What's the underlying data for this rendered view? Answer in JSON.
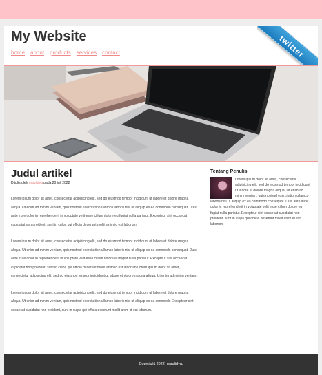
{
  "site": {
    "title": "My Website",
    "nav": [
      "home",
      "about",
      "products",
      "services",
      "contact"
    ],
    "ribbon_label": "twitter"
  },
  "article": {
    "title": "Judul artikel",
    "byline_prefix": "Ditulis oleh",
    "byline_author": "maulidya",
    "byline_suffix": "pada 20 juli 2022",
    "paragraphs": [
      "Lorem ipsum dolor sit amet, consectetur adipisicing elit, sed do eiusmod tempor incididunt ut labore et dolore magna aliqua. Ut enim ad minim veniam, quis nostrud exercitation ullamco laboris nisi ut aliquip ex ea commodo consequat. Duis aute irure dolor in reprehenderit in voluptate velit esse cillum dolore eu fugiat nulla pariatur. Excepteur sint occaecat cupidatat non proident, sunt in culpa qui officia deserunt mollit anim id est laborum.",
      "Lorem ipsum dolor sit amet, consectetur adipisicing elit, sed do eiusmod tempor incididunt ut labore et dolore magna aliqua. Ut enim ad minim veniam, quis nostrud exercitation ullamco laboris nisi ut aliquip ex ea commodo consequat. Duis aute irure dolor in reprehenderit in voluptate velit esse cillum dolore eu fugiat nulla pariatur. Excepteur sint occaecat cupidatat non proident, sunt in culpa qui officia deserunt mollit anim id est laborum.Lorem ipsum dolor sit amet, consectetur adipisicing elit, sed do eiusmod tempor incididunt ut labore et dolore magna aliqua. Ut enim ad minim veniam.",
      "Lorem ipsum dolor sit amet, consectetur adipisicing elit, sed do eiusmod tempor incididunt ut labore et dolore magna aliqua. Ut enim ad minim veniam, quis nostrud exercitation ullamco laboris nisi ut aliquip ex ea commodo Excepteur sint occaecat cupidatat non proident, sunt in culpa qui officia deserunt mollit anim id est laborum."
    ]
  },
  "sidebar": {
    "title": "Tentang Penulis",
    "text": "Lorem ipsum dolor sit amet, consectetur adipisicing elit, sed do eiusmod tempor incididunt ut labore et dolore magna aliqua. Ut enim ad minim veniam, quis nostrud exercitation ullamco laboris nisi ut aliquip ex ea commodo consequat. Duis aute irure dolor in reprehenderit in voluptate velit esse cillum dolore eu fugiat nulla pariatur. Excepteur sint occaecat cupidatat non proident, sunt in culpa qui officia deserunt mollit anim id est laborum."
  },
  "footer": {
    "text": "Copyright 2022. maulidya."
  },
  "colors": {
    "top_bar": "#fec3c9",
    "accent_line": "#f09a9a",
    "nav_link": "#f08a8a",
    "ribbon": "#1d7bbd",
    "footer": "#333333"
  },
  "icons": {
    "ribbon": "twitter-ribbon-icon",
    "avatar": "author-avatar"
  }
}
